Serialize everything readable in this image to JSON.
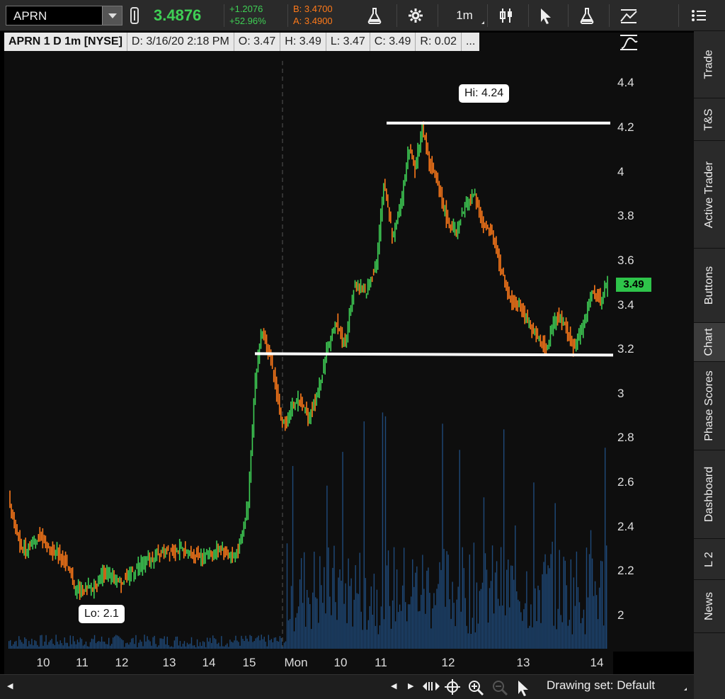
{
  "toolbar": {
    "symbol": "APRN",
    "last_price": "3.4876",
    "change": "+1.2076",
    "change_pct": "+52.96%",
    "bid": "B: 3.4700",
    "ask": "A: 3.4900",
    "timeframe": "1m",
    "icons": [
      "link-icon",
      "flask-icon",
      "gear-icon",
      "candlestick-icon",
      "cursor-icon",
      "flask-icon",
      "drawing-icon",
      "menu-icon"
    ]
  },
  "infobar": {
    "title": "APRN 1 D 1m [NYSE]",
    "date": "D: 3/16/20 2:18 PM",
    "open": "O: 3.47",
    "high": "H: 3.49",
    "low": "L: 3.47",
    "close": "C: 3.49",
    "range": "R: 0.02",
    "more": "..."
  },
  "chart": {
    "current_price_flag": "3.49",
    "hi_label": "Hi: 4.24",
    "lo_label": "Lo: 2.1",
    "colors": {
      "up": "#3fcf55",
      "down": "#ff7a1a",
      "volume": "#1f4a7a",
      "hline": "#ffffff"
    },
    "horizontal_lines": [
      4.22,
      3.18
    ]
  },
  "chart_data": {
    "type": "candlestick",
    "ylim": [
      1.85,
      4.5
    ],
    "y_ticks": [
      "4.4",
      "4.2",
      "4",
      "3.8",
      "3.6",
      "3.4",
      "3.2",
      "3",
      "2.8",
      "2.6",
      "2.4",
      "2.2",
      "2"
    ],
    "y_tick_values": [
      4.4,
      4.2,
      4.0,
      3.8,
      3.6,
      3.4,
      3.2,
      3.0,
      2.8,
      2.6,
      2.4,
      2.2,
      2.0
    ],
    "x_ticks": [
      "10",
      "11",
      "12",
      "13",
      "14",
      "15",
      "Mon",
      "10",
      "11",
      "12",
      "13",
      "14"
    ],
    "price_path": [
      [
        0,
        2.52
      ],
      [
        3,
        2.4
      ],
      [
        6,
        2.3
      ],
      [
        10,
        2.32
      ],
      [
        14,
        2.36
      ],
      [
        18,
        2.3
      ],
      [
        22,
        2.28
      ],
      [
        26,
        2.22
      ],
      [
        29,
        2.13
      ],
      [
        33,
        2.11
      ],
      [
        38,
        2.13
      ],
      [
        42,
        2.2
      ],
      [
        46,
        2.17
      ],
      [
        50,
        2.15
      ],
      [
        55,
        2.2
      ],
      [
        60,
        2.24
      ],
      [
        66,
        2.27
      ],
      [
        72,
        2.3
      ],
      [
        78,
        2.29
      ],
      [
        84,
        2.27
      ],
      [
        90,
        2.28
      ],
      [
        95,
        2.3
      ],
      [
        100,
        2.26
      ],
      [
        103,
        2.35
      ],
      [
        106,
        2.5
      ],
      [
        109,
        3.05
      ],
      [
        112,
        3.3
      ],
      [
        115,
        3.2
      ],
      [
        118,
        3.05
      ],
      [
        121,
        2.86
      ],
      [
        124,
        2.9
      ],
      [
        128,
        2.98
      ],
      [
        133,
        2.9
      ],
      [
        137,
        3.0
      ],
      [
        141,
        3.2
      ],
      [
        145,
        3.32
      ],
      [
        149,
        3.22
      ],
      [
        153,
        3.5
      ],
      [
        158,
        3.45
      ],
      [
        163,
        3.6
      ],
      [
        166,
        3.95
      ],
      [
        170,
        3.7
      ],
      [
        174,
        3.88
      ],
      [
        177,
        4.12
      ],
      [
        180,
        4.02
      ],
      [
        183,
        4.2
      ],
      [
        186,
        4.05
      ],
      [
        190,
        3.95
      ],
      [
        194,
        3.78
      ],
      [
        198,
        3.72
      ],
      [
        202,
        3.85
      ],
      [
        206,
        3.9
      ],
      [
        210,
        3.75
      ],
      [
        214,
        3.72
      ],
      [
        218,
        3.55
      ],
      [
        222,
        3.42
      ],
      [
        226,
        3.4
      ],
      [
        230,
        3.32
      ],
      [
        234,
        3.25
      ],
      [
        238,
        3.2
      ],
      [
        242,
        3.35
      ],
      [
        246,
        3.32
      ],
      [
        250,
        3.2
      ],
      [
        254,
        3.3
      ],
      [
        258,
        3.45
      ],
      [
        262,
        3.42
      ],
      [
        265,
        3.5
      ]
    ],
    "high": 4.24,
    "low": 2.1,
    "last": 3.49
  },
  "bottombar": {
    "drawing_set": "Drawing set: Default"
  },
  "right_tabs": [
    "Trade",
    "T&S",
    "Active Trader",
    "Buttons",
    "Chart",
    "Phase Scores",
    "Dashboard",
    "L 2",
    "News"
  ],
  "active_tab": "Chart"
}
